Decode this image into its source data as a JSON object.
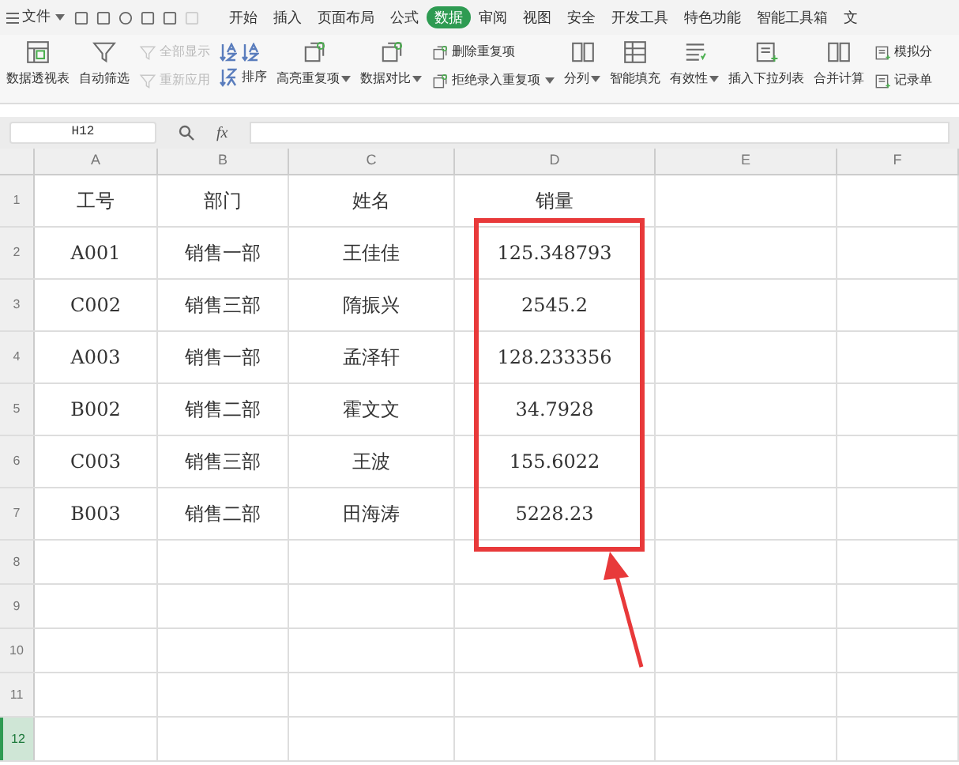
{
  "menu": {
    "label": "文件"
  },
  "tabs": [
    {
      "label": "开始",
      "selected": false
    },
    {
      "label": "插入",
      "selected": false
    },
    {
      "label": "页面布局",
      "selected": false
    },
    {
      "label": "公式",
      "selected": false
    },
    {
      "label": "数据",
      "selected": true
    },
    {
      "label": "审阅",
      "selected": false
    },
    {
      "label": "视图",
      "selected": false
    },
    {
      "label": "安全",
      "selected": false
    },
    {
      "label": "开发工具",
      "selected": false
    },
    {
      "label": "特色功能",
      "selected": false
    },
    {
      "label": "智能工具箱",
      "selected": false
    },
    {
      "label": "文",
      "selected": false
    }
  ],
  "ribbon": [
    {
      "kind": "large",
      "label": "数据透视表",
      "has_menu": false
    },
    {
      "kind": "large",
      "label": "自动筛选",
      "has_menu": false
    },
    {
      "kind": "stack",
      "items": [
        {
          "label": "全部显示",
          "has_menu": false,
          "disabled": true
        },
        {
          "label": "重新应用",
          "has_menu": false,
          "disabled": true
        }
      ]
    },
    {
      "kind": "sort",
      "label": "排序",
      "has_menu": false
    },
    {
      "kind": "large",
      "label": "高亮重复项",
      "has_menu": true
    },
    {
      "kind": "large",
      "label": "数据对比",
      "has_menu": true
    },
    {
      "kind": "stack",
      "items": [
        {
          "label": "删除重复项",
          "has_menu": false,
          "disabled": false
        },
        {
          "label": "拒绝录入重复项",
          "has_menu": true,
          "disabled": false
        }
      ]
    },
    {
      "kind": "large",
      "label": "分列",
      "has_menu": true
    },
    {
      "kind": "large",
      "label": "智能填充",
      "has_menu": false
    },
    {
      "kind": "large",
      "label": "有效性",
      "has_menu": true
    },
    {
      "kind": "large",
      "label": "插入下拉列表",
      "has_menu": false
    },
    {
      "kind": "large",
      "label": "合并计算",
      "has_menu": false
    },
    {
      "kind": "stack",
      "items": [
        {
          "label": "模拟分",
          "has_menu": false,
          "disabled": false
        },
        {
          "label": "记录单",
          "has_menu": false,
          "disabled": false
        }
      ]
    }
  ],
  "name_box": "H12",
  "formula_bar": {
    "label": "fx"
  },
  "sheet": {
    "columns": [
      {
        "label": "A",
        "selected": false
      },
      {
        "label": "B",
        "selected": false
      },
      {
        "label": "C",
        "selected": false
      },
      {
        "label": "D",
        "selected": false
      },
      {
        "label": "E",
        "selected": false
      },
      {
        "label": "F",
        "selected": false
      }
    ],
    "rows": [
      {
        "number": "1",
        "selected": false,
        "cells": [
          "工号",
          "部门",
          "姓名",
          "销量"
        ]
      },
      {
        "number": "2",
        "selected": false,
        "cells": [
          "A001",
          "销售一部",
          "王佳佳",
          "125.348793"
        ]
      },
      {
        "number": "3",
        "selected": false,
        "cells": [
          "C002",
          "销售三部",
          "隋振兴",
          "2545.2"
        ]
      },
      {
        "number": "4",
        "selected": false,
        "cells": [
          "A003",
          "销售一部",
          "孟泽轩",
          "128.233356"
        ]
      },
      {
        "number": "5",
        "selected": false,
        "cells": [
          "B002",
          "销售二部",
          "霍文文",
          "34.7928"
        ]
      },
      {
        "number": "6",
        "selected": false,
        "cells": [
          "C003",
          "销售三部",
          "王波",
          "155.6022"
        ]
      },
      {
        "number": "7",
        "selected": false,
        "cells": [
          "B003",
          "销售二部",
          "田海涛",
          "5228.23"
        ]
      },
      {
        "number": "8",
        "selected": false,
        "cells": []
      },
      {
        "number": "9",
        "selected": false,
        "cells": []
      },
      {
        "number": "10",
        "selected": false,
        "cells": []
      },
      {
        "number": "11",
        "selected": false,
        "cells": []
      },
      {
        "number": "12",
        "selected": true,
        "cells": []
      }
    ]
  },
  "annotation": {
    "kind": "box-arrow"
  }
}
